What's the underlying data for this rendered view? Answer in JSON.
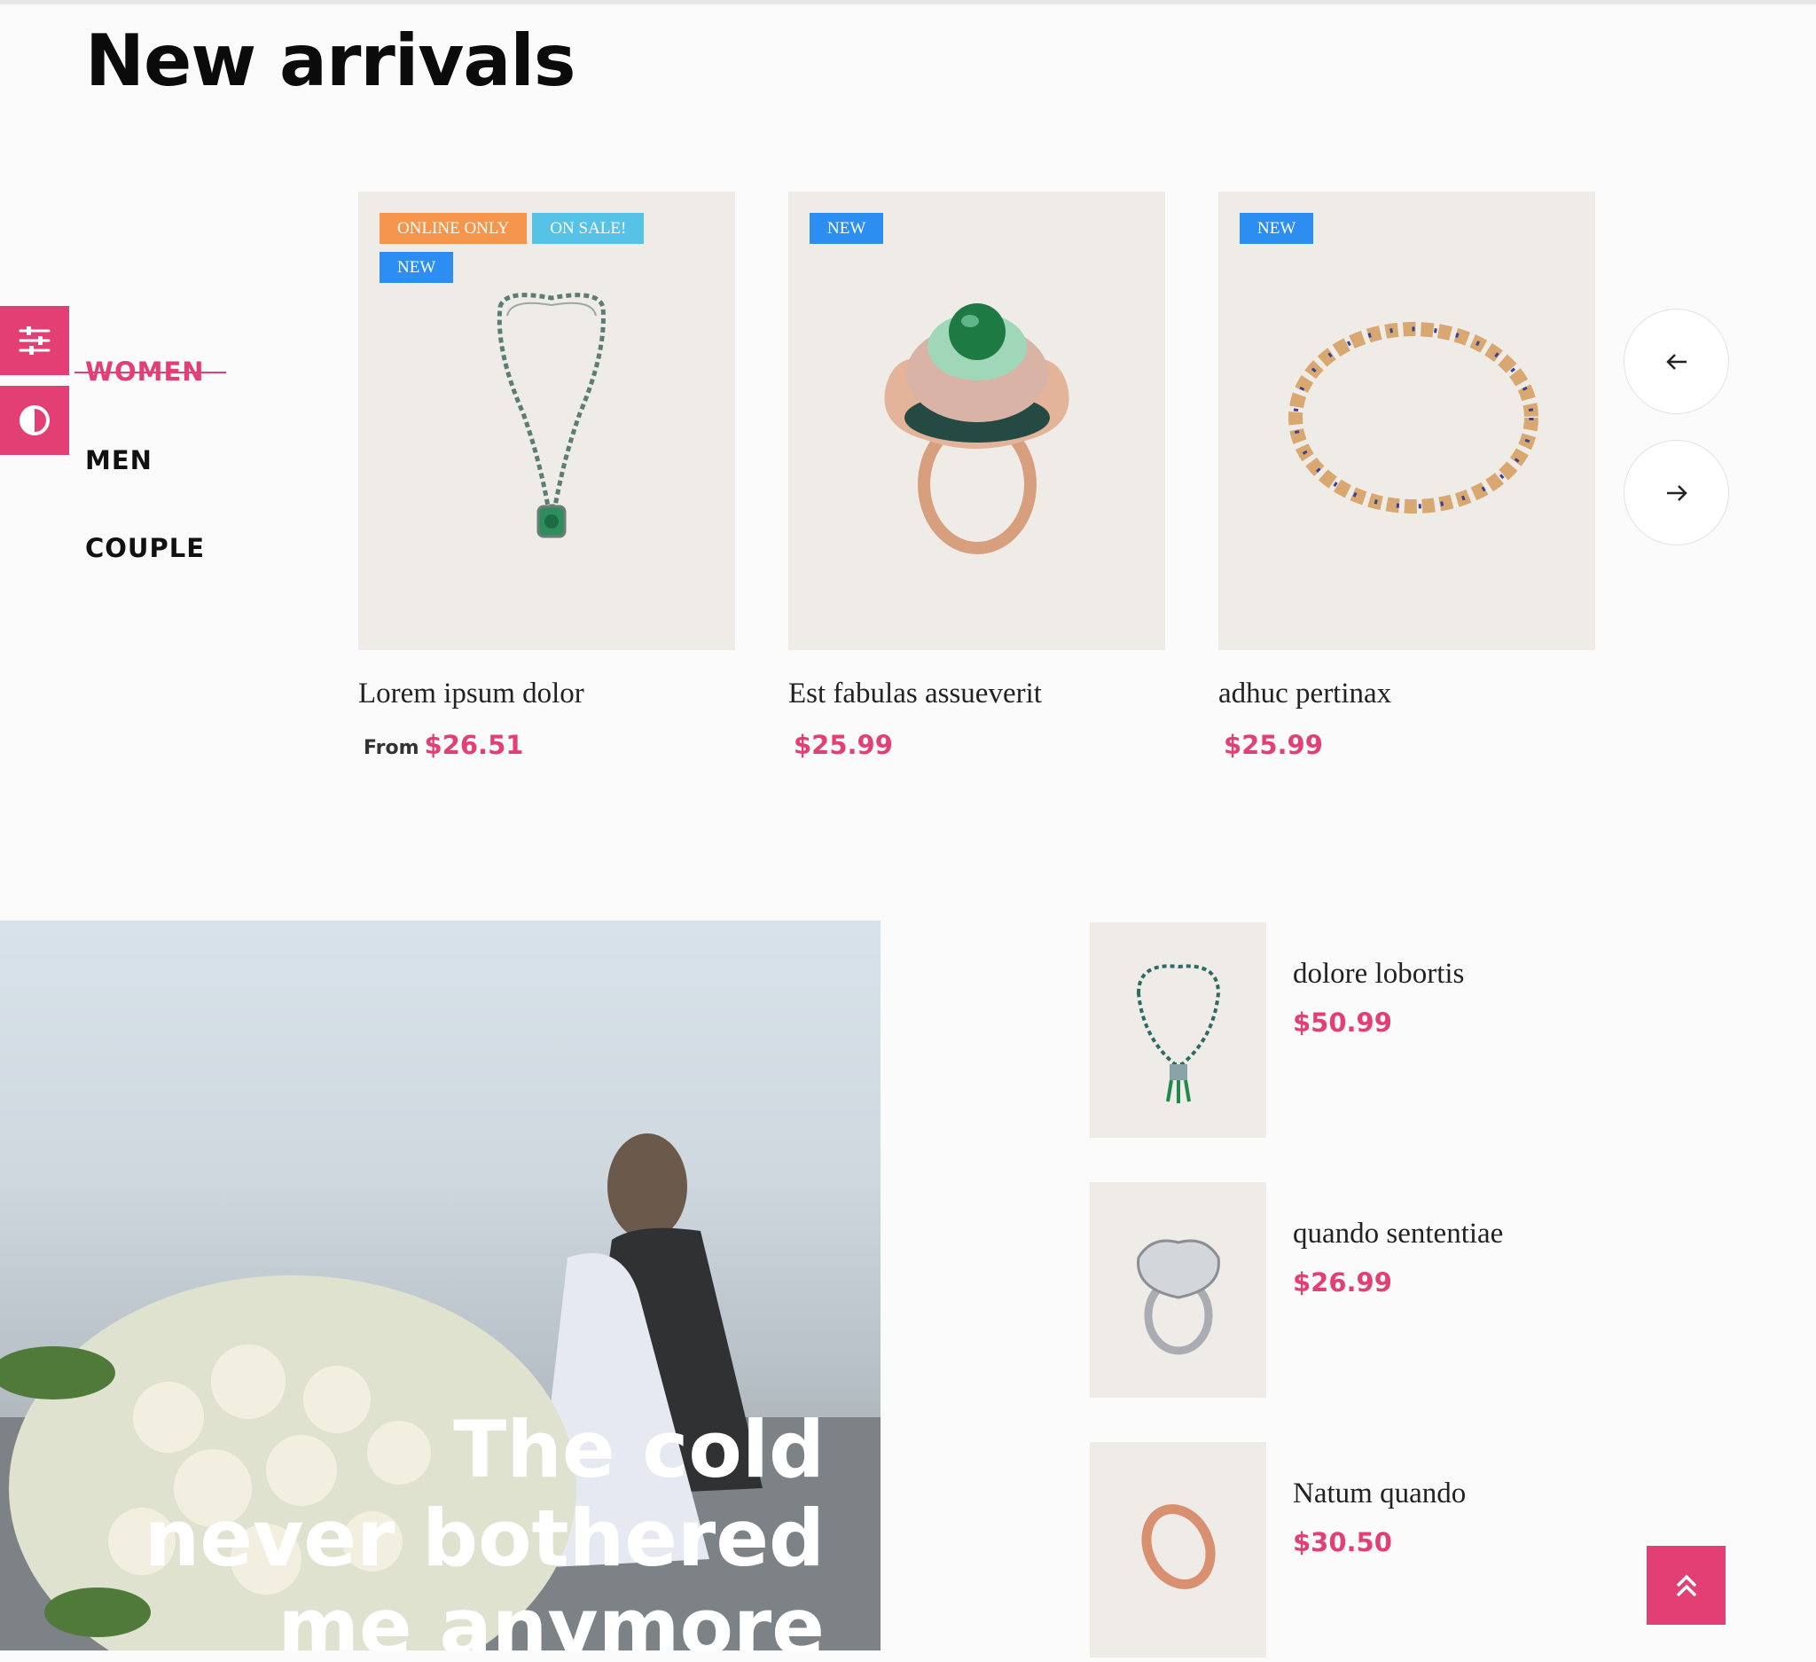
{
  "page": {
    "title": "New arrivals"
  },
  "categories": [
    {
      "label": "WOMEN",
      "active": true
    },
    {
      "label": "MEN",
      "active": false
    },
    {
      "label": "COUPLE",
      "active": false
    }
  ],
  "products": [
    {
      "name": "Lorem ipsum dolor",
      "price_prefix": "From",
      "price": "$26.51",
      "badges": [
        "ONLINE ONLY",
        "ON SALE!",
        "NEW"
      ],
      "image": "emerald-pendant-necklace"
    },
    {
      "name": "Est fabulas assueverit",
      "price_prefix": "",
      "price": "$25.99",
      "badges": [
        "NEW"
      ],
      "image": "rose-gold-cocktail-ring"
    },
    {
      "name": "adhuc pertinax",
      "price_prefix": "",
      "price": "$25.99",
      "badges": [
        "NEW"
      ],
      "image": "gold-sapphire-bracelet"
    }
  ],
  "carousel": {
    "prev_icon": "arrow-left-icon",
    "next_icon": "arrow-right-icon"
  },
  "banner": {
    "line1": "The cold",
    "line2": "never bothered",
    "line3": "me anymore"
  },
  "side_products": [
    {
      "name": "dolore lobortis",
      "price": "$50.99",
      "image": "tassel-pendant-necklace"
    },
    {
      "name": "quando sententiae",
      "price": "$26.99",
      "image": "diamond-ring"
    },
    {
      "name": "Natum quando",
      "price": "$30.50",
      "image": "rose-gold-band"
    }
  ],
  "tools": {
    "filter_icon": "sliders-icon",
    "contrast_icon": "contrast-icon",
    "scroll_top_icon": "double-chevron-up-icon"
  },
  "colors": {
    "accent": "#e23f75",
    "badge_orange": "#f6954c",
    "badge_cyan": "#56c3e6",
    "badge_blue": "#2d8ef1",
    "thumb_bg": "#efebe7"
  }
}
